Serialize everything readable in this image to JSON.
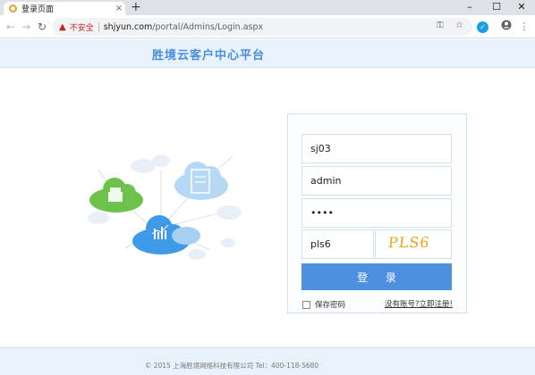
{
  "browser": {
    "tab_title": "登录页面",
    "tab_close": "×",
    "new_tab": "+",
    "window_controls": [
      "–",
      "☐",
      "✕"
    ],
    "nav": {
      "back": "←",
      "forward": "→",
      "reload": "↻"
    },
    "security_label": "不安全",
    "url_host": "shjyun.com",
    "url_path": "/portal/Admins/Login.aspx",
    "icons": [
      "key-icon",
      "star-icon",
      "extension-icon",
      "account-icon",
      "menu-icon"
    ]
  },
  "header": {
    "title": "胜境云客户中心平台"
  },
  "login": {
    "username": "sj03",
    "company": "admin",
    "password": "••••",
    "captcha_input": "pls6",
    "captcha_image_text": "PLS6",
    "submit_label": "登 录",
    "remember_label": "保存密码",
    "register_link": "没有账号?立即注册!"
  },
  "footer": {
    "copyright": "© 2015 上海胜境网络科技有限公司 Tel：400-118-5680"
  },
  "colors": {
    "accent": "#4d90e0",
    "header_bg": "#e8f2fd",
    "captcha": "#e8a21a"
  }
}
